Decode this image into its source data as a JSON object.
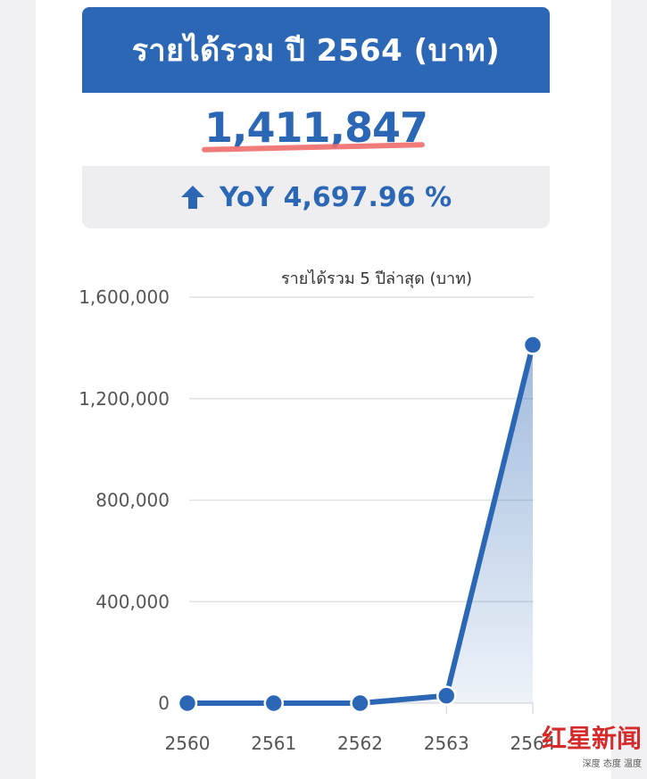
{
  "header": {
    "title": "รายได้รวม ปี 2564 (บาท)",
    "total_value": "1,411,847",
    "yoy_label": "YoY 4,697.96 %",
    "accent_color": "#2b67b4",
    "underline_color": "#f06b6b",
    "arrow_icon": "arrow-up-icon"
  },
  "chart_data": {
    "type": "line",
    "title": "รายได้รวม 5 ปีล่าสุด (บาท)",
    "categories": [
      "2560",
      "2561",
      "2562",
      "2563",
      "2564"
    ],
    "series": [
      {
        "values": [
          0,
          0,
          0,
          29400,
          1411847
        ]
      }
    ],
    "yticks": [
      "0",
      "400,000",
      "800,000",
      "1,200,000",
      "1,600,000"
    ],
    "ylim": [
      0,
      1600000
    ],
    "grid": true,
    "area_fill": true,
    "line_color": "#2b67b4"
  },
  "watermark": {
    "main": "红星新闻",
    "sub": "深度 态度 温度"
  }
}
